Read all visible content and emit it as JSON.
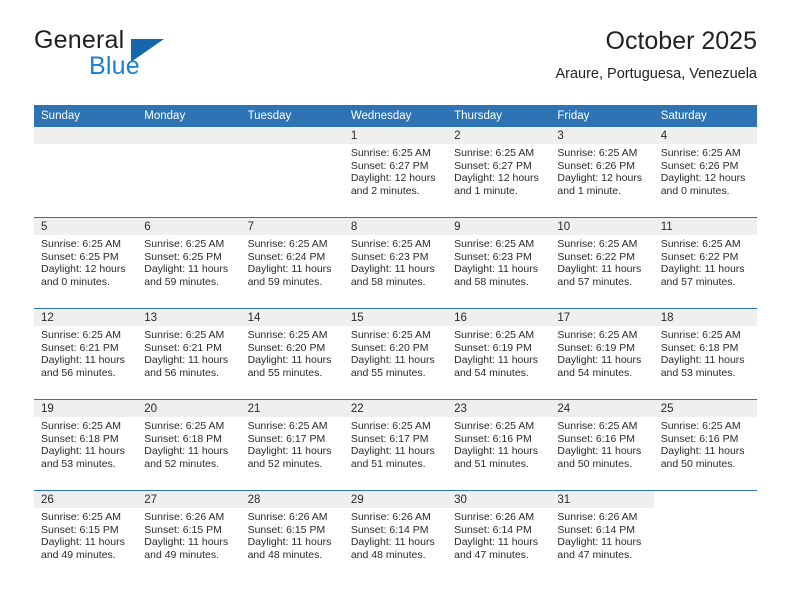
{
  "brand": {
    "name_part1": "General",
    "name_part2": "Blue",
    "logo_icon": "triangle-logo-icon"
  },
  "header": {
    "title": "October 2025",
    "location": "Araure, Portuguesa, Venezuela"
  },
  "calendar": {
    "weekday_headers": [
      "Sunday",
      "Monday",
      "Tuesday",
      "Wednesday",
      "Thursday",
      "Friday",
      "Saturday"
    ],
    "accent_color": "#2e74b5",
    "daynum_background": "#efefef",
    "weeks": [
      [
        {
          "day": "",
          "empty": true
        },
        {
          "day": "",
          "empty": true
        },
        {
          "day": "",
          "empty": true
        },
        {
          "day": "1",
          "sunrise": "Sunrise: 6:25 AM",
          "sunset": "Sunset: 6:27 PM",
          "daylight_line1": "Daylight: 12 hours",
          "daylight_line2": "and 2 minutes."
        },
        {
          "day": "2",
          "sunrise": "Sunrise: 6:25 AM",
          "sunset": "Sunset: 6:27 PM",
          "daylight_line1": "Daylight: 12 hours",
          "daylight_line2": "and 1 minute."
        },
        {
          "day": "3",
          "sunrise": "Sunrise: 6:25 AM",
          "sunset": "Sunset: 6:26 PM",
          "daylight_line1": "Daylight: 12 hours",
          "daylight_line2": "and 1 minute."
        },
        {
          "day": "4",
          "sunrise": "Sunrise: 6:25 AM",
          "sunset": "Sunset: 6:26 PM",
          "daylight_line1": "Daylight: 12 hours",
          "daylight_line2": "and 0 minutes."
        }
      ],
      [
        {
          "day": "5",
          "sunrise": "Sunrise: 6:25 AM",
          "sunset": "Sunset: 6:25 PM",
          "daylight_line1": "Daylight: 12 hours",
          "daylight_line2": "and 0 minutes."
        },
        {
          "day": "6",
          "sunrise": "Sunrise: 6:25 AM",
          "sunset": "Sunset: 6:25 PM",
          "daylight_line1": "Daylight: 11 hours",
          "daylight_line2": "and 59 minutes."
        },
        {
          "day": "7",
          "sunrise": "Sunrise: 6:25 AM",
          "sunset": "Sunset: 6:24 PM",
          "daylight_line1": "Daylight: 11 hours",
          "daylight_line2": "and 59 minutes."
        },
        {
          "day": "8",
          "sunrise": "Sunrise: 6:25 AM",
          "sunset": "Sunset: 6:23 PM",
          "daylight_line1": "Daylight: 11 hours",
          "daylight_line2": "and 58 minutes."
        },
        {
          "day": "9",
          "sunrise": "Sunrise: 6:25 AM",
          "sunset": "Sunset: 6:23 PM",
          "daylight_line1": "Daylight: 11 hours",
          "daylight_line2": "and 58 minutes."
        },
        {
          "day": "10",
          "sunrise": "Sunrise: 6:25 AM",
          "sunset": "Sunset: 6:22 PM",
          "daylight_line1": "Daylight: 11 hours",
          "daylight_line2": "and 57 minutes."
        },
        {
          "day": "11",
          "sunrise": "Sunrise: 6:25 AM",
          "sunset": "Sunset: 6:22 PM",
          "daylight_line1": "Daylight: 11 hours",
          "daylight_line2": "and 57 minutes."
        }
      ],
      [
        {
          "day": "12",
          "sunrise": "Sunrise: 6:25 AM",
          "sunset": "Sunset: 6:21 PM",
          "daylight_line1": "Daylight: 11 hours",
          "daylight_line2": "and 56 minutes."
        },
        {
          "day": "13",
          "sunrise": "Sunrise: 6:25 AM",
          "sunset": "Sunset: 6:21 PM",
          "daylight_line1": "Daylight: 11 hours",
          "daylight_line2": "and 56 minutes."
        },
        {
          "day": "14",
          "sunrise": "Sunrise: 6:25 AM",
          "sunset": "Sunset: 6:20 PM",
          "daylight_line1": "Daylight: 11 hours",
          "daylight_line2": "and 55 minutes."
        },
        {
          "day": "15",
          "sunrise": "Sunrise: 6:25 AM",
          "sunset": "Sunset: 6:20 PM",
          "daylight_line1": "Daylight: 11 hours",
          "daylight_line2": "and 55 minutes."
        },
        {
          "day": "16",
          "sunrise": "Sunrise: 6:25 AM",
          "sunset": "Sunset: 6:19 PM",
          "daylight_line1": "Daylight: 11 hours",
          "daylight_line2": "and 54 minutes."
        },
        {
          "day": "17",
          "sunrise": "Sunrise: 6:25 AM",
          "sunset": "Sunset: 6:19 PM",
          "daylight_line1": "Daylight: 11 hours",
          "daylight_line2": "and 54 minutes."
        },
        {
          "day": "18",
          "sunrise": "Sunrise: 6:25 AM",
          "sunset": "Sunset: 6:18 PM",
          "daylight_line1": "Daylight: 11 hours",
          "daylight_line2": "and 53 minutes."
        }
      ],
      [
        {
          "day": "19",
          "sunrise": "Sunrise: 6:25 AM",
          "sunset": "Sunset: 6:18 PM",
          "daylight_line1": "Daylight: 11 hours",
          "daylight_line2": "and 53 minutes."
        },
        {
          "day": "20",
          "sunrise": "Sunrise: 6:25 AM",
          "sunset": "Sunset: 6:18 PM",
          "daylight_line1": "Daylight: 11 hours",
          "daylight_line2": "and 52 minutes."
        },
        {
          "day": "21",
          "sunrise": "Sunrise: 6:25 AM",
          "sunset": "Sunset: 6:17 PM",
          "daylight_line1": "Daylight: 11 hours",
          "daylight_line2": "and 52 minutes."
        },
        {
          "day": "22",
          "sunrise": "Sunrise: 6:25 AM",
          "sunset": "Sunset: 6:17 PM",
          "daylight_line1": "Daylight: 11 hours",
          "daylight_line2": "and 51 minutes."
        },
        {
          "day": "23",
          "sunrise": "Sunrise: 6:25 AM",
          "sunset": "Sunset: 6:16 PM",
          "daylight_line1": "Daylight: 11 hours",
          "daylight_line2": "and 51 minutes."
        },
        {
          "day": "24",
          "sunrise": "Sunrise: 6:25 AM",
          "sunset": "Sunset: 6:16 PM",
          "daylight_line1": "Daylight: 11 hours",
          "daylight_line2": "and 50 minutes."
        },
        {
          "day": "25",
          "sunrise": "Sunrise: 6:25 AM",
          "sunset": "Sunset: 6:16 PM",
          "daylight_line1": "Daylight: 11 hours",
          "daylight_line2": "and 50 minutes."
        }
      ],
      [
        {
          "day": "26",
          "sunrise": "Sunrise: 6:25 AM",
          "sunset": "Sunset: 6:15 PM",
          "daylight_line1": "Daylight: 11 hours",
          "daylight_line2": "and 49 minutes."
        },
        {
          "day": "27",
          "sunrise": "Sunrise: 6:26 AM",
          "sunset": "Sunset: 6:15 PM",
          "daylight_line1": "Daylight: 11 hours",
          "daylight_line2": "and 49 minutes."
        },
        {
          "day": "28",
          "sunrise": "Sunrise: 6:26 AM",
          "sunset": "Sunset: 6:15 PM",
          "daylight_line1": "Daylight: 11 hours",
          "daylight_line2": "and 48 minutes."
        },
        {
          "day": "29",
          "sunrise": "Sunrise: 6:26 AM",
          "sunset": "Sunset: 6:14 PM",
          "daylight_line1": "Daylight: 11 hours",
          "daylight_line2": "and 48 minutes."
        },
        {
          "day": "30",
          "sunrise": "Sunrise: 6:26 AM",
          "sunset": "Sunset: 6:14 PM",
          "daylight_line1": "Daylight: 11 hours",
          "daylight_line2": "and 47 minutes."
        },
        {
          "day": "31",
          "sunrise": "Sunrise: 6:26 AM",
          "sunset": "Sunset: 6:14 PM",
          "daylight_line1": "Daylight: 11 hours",
          "daylight_line2": "and 47 minutes."
        },
        {
          "day": "",
          "empty": true,
          "no_band": true
        }
      ]
    ]
  }
}
